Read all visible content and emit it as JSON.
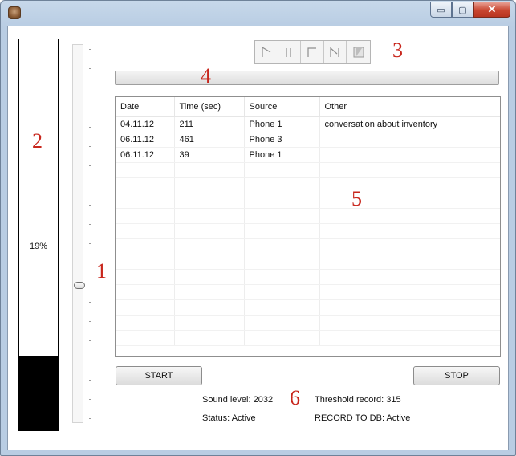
{
  "window": {
    "caption_buttons": {
      "minimize": "▭",
      "maximize": "▢",
      "close": "✕"
    }
  },
  "level_meter": {
    "text": "19%",
    "fill_fraction": 0.19
  },
  "slider": {
    "value_fraction": 0.36,
    "tick_count": 20
  },
  "transport": {
    "icons": [
      "play-icon",
      "pause-icon",
      "stop-icon",
      "skip-icon",
      "rewind-icon"
    ]
  },
  "table": {
    "columns": [
      "Date",
      "Time (sec)",
      "Source",
      "Other"
    ],
    "rows": [
      [
        "04.11.12",
        "211",
        "Phone 1",
        "conversation about inventory"
      ],
      [
        "06.11.12",
        "461",
        "Phone 3",
        ""
      ],
      [
        "06.11.12",
        "39",
        "Phone 1",
        ""
      ],
      [
        "",
        "",
        "",
        ""
      ],
      [
        "",
        "",
        "",
        ""
      ],
      [
        "",
        "",
        "",
        ""
      ],
      [
        "",
        "",
        "",
        ""
      ],
      [
        "",
        "",
        "",
        ""
      ],
      [
        "",
        "",
        "",
        ""
      ],
      [
        "",
        "",
        "",
        ""
      ],
      [
        "",
        "",
        "",
        ""
      ],
      [
        "",
        "",
        "",
        ""
      ],
      [
        "",
        "",
        "",
        ""
      ],
      [
        "",
        "",
        "",
        ""
      ],
      [
        "",
        "",
        "",
        ""
      ]
    ]
  },
  "buttons": {
    "start": "START",
    "stop": "STOP"
  },
  "status": {
    "sound_level": "Sound level:  2032",
    "threshold": "Threshold record: 315",
    "status": "Status: Active",
    "record_db": "RECORD TO DB: Active"
  },
  "annotations": {
    "a1": "1",
    "a2": "2",
    "a3": "3",
    "a4": "4",
    "a5": "5",
    "a6": "6"
  },
  "colors": {
    "annotation": "#c8261c",
    "meter_fill": "#000000"
  }
}
